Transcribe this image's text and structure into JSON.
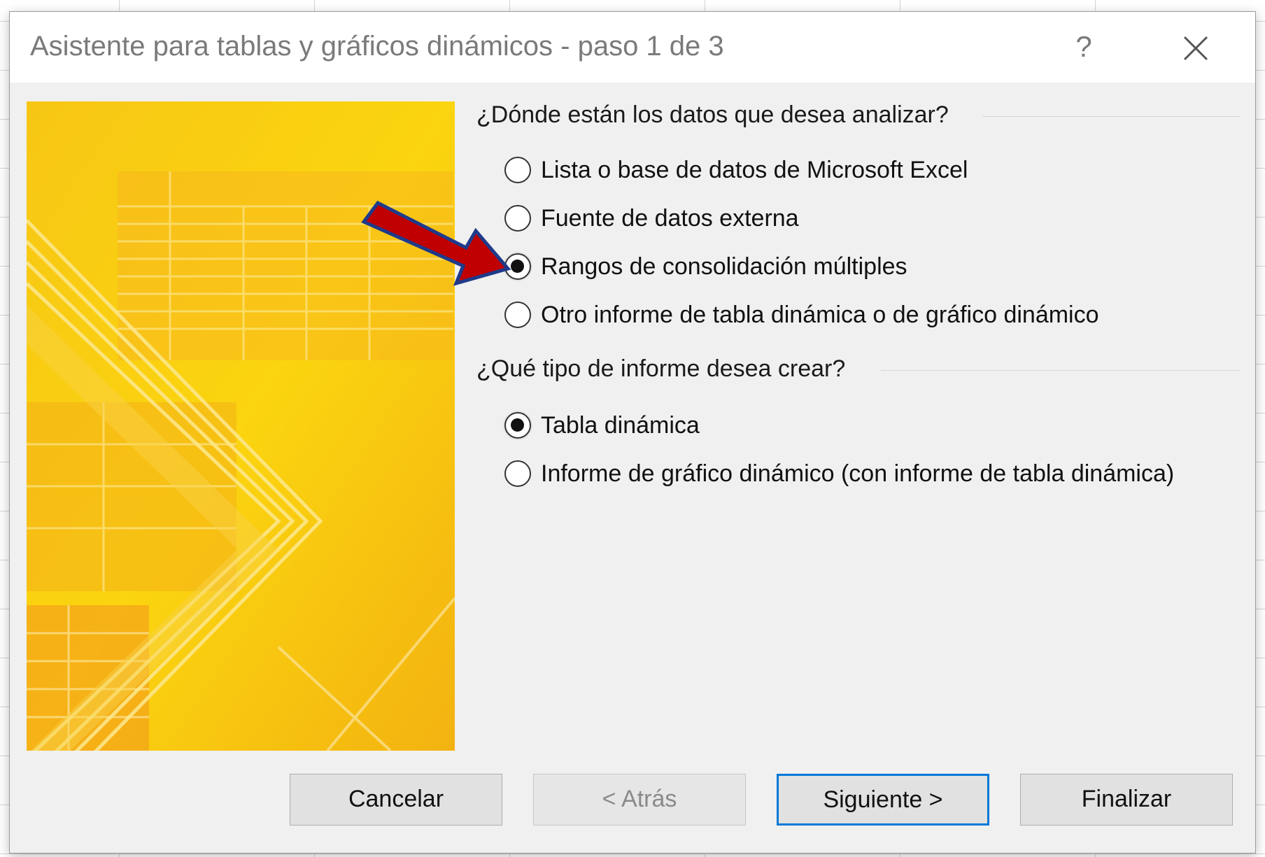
{
  "dialog": {
    "title": "Asistente para tablas y gráficos dinámicos - paso 1 de 3",
    "help_label": "?",
    "close_icon": "close-icon"
  },
  "source_group": {
    "label": "¿Dónde están los datos que desea analizar?",
    "options": [
      {
        "label": "Lista o base de datos de Microsoft Excel",
        "checked": false
      },
      {
        "label": "Fuente de datos externa",
        "checked": false
      },
      {
        "label": "Rangos de consolidación múltiples",
        "checked": true
      },
      {
        "label": "Otro informe de tabla dinámica o de gráfico dinámico",
        "checked": false
      }
    ]
  },
  "report_group": {
    "label": "¿Qué tipo de informe desea crear?",
    "options": [
      {
        "label": "Tabla dinámica",
        "checked": true
      },
      {
        "label": "Informe de gráfico dinámico (con informe de tabla dinámica)",
        "checked": false
      }
    ]
  },
  "buttons": {
    "cancel": "Cancelar",
    "back": "< Atrás",
    "next": "Siguiente >",
    "finish": "Finalizar"
  },
  "annotation": {
    "arrow_color": "#c00000",
    "arrow_outline": "#1f3a8a"
  },
  "colors": {
    "accent": "#0078d7",
    "art_yellow": "#f9c80e"
  }
}
